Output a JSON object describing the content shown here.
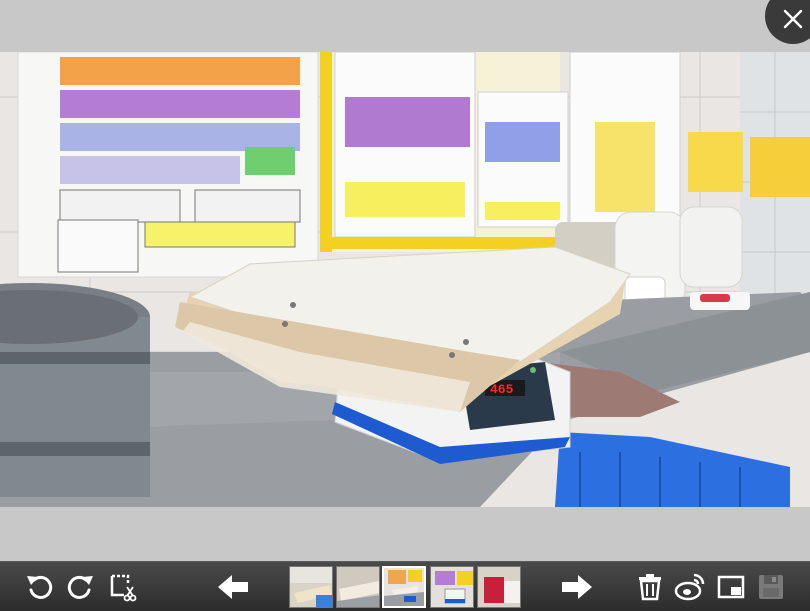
{
  "viewer": {
    "close_icon": "close-icon",
    "photo": {
      "scale_display": "465"
    }
  },
  "toolbar": {
    "buttons": [
      {
        "name": "rotate-left",
        "icon": "rotate-left-icon"
      },
      {
        "name": "rotate-right",
        "icon": "rotate-right-icon"
      },
      {
        "name": "crop",
        "icon": "crop-icon"
      },
      {
        "name": "previous",
        "icon": "arrow-left-icon"
      },
      {
        "name": "next",
        "icon": "arrow-right-icon"
      },
      {
        "name": "delete",
        "icon": "trash-icon"
      },
      {
        "name": "share-weibo",
        "icon": "weibo-icon"
      },
      {
        "name": "set-wallpaper",
        "icon": "picture-in-picture-icon"
      },
      {
        "name": "save",
        "icon": "save-icon"
      }
    ],
    "thumbnails": [
      {
        "name": "thumb-1",
        "active": false
      },
      {
        "name": "thumb-2",
        "active": false
      },
      {
        "name": "thumb-3",
        "active": true
      },
      {
        "name": "thumb-4",
        "active": false
      },
      {
        "name": "thumb-5",
        "active": false
      }
    ]
  },
  "colors": {
    "background": "#c8c8c8",
    "toolbar": "#3a3a3a",
    "scale_digits": "#ff2a2a",
    "scale_base": "#1f5bd0"
  }
}
